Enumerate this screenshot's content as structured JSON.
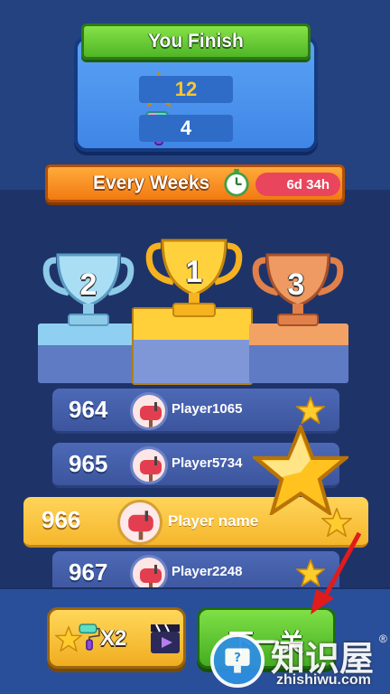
{
  "result": {
    "title": "You Finish",
    "stars": "12",
    "rollers": "4"
  },
  "weekly": {
    "label": "Every Weeks",
    "timer": "6d 34h"
  },
  "podium": [
    "1",
    "2",
    "3"
  ],
  "leaderboard": [
    {
      "rank": "964",
      "name": "Player1065"
    },
    {
      "rank": "965",
      "name": "Player5734"
    },
    {
      "rank": "966",
      "name": "Player name"
    },
    {
      "rank": "967",
      "name": "Player2248"
    }
  ],
  "buttons": {
    "multiplier": "X2",
    "next": "下一关"
  },
  "watermark": {
    "title": "知识屋",
    "url": "zhishiwu.com",
    "reg": "®"
  },
  "colors": {
    "background": "#1e3469",
    "highlight_row": "#f5b72c",
    "next_button": "#45ad22",
    "banner_green": "#4fb626",
    "banner_orange": "#f27a12"
  }
}
